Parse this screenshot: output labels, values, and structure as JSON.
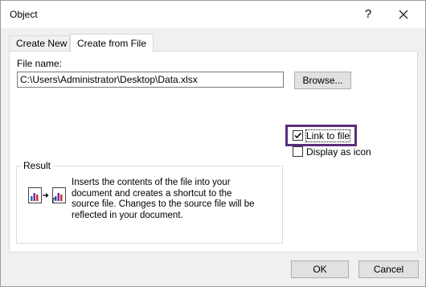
{
  "window": {
    "title": "Object",
    "help_glyph": "?",
    "close_icon": "close-icon"
  },
  "tabs": [
    {
      "label": "Create New",
      "active": false
    },
    {
      "label": "Create from File",
      "active": true
    }
  ],
  "file": {
    "label": "File name:",
    "value": "C:\\Users\\Administrator\\Desktop\\Data.xlsx",
    "browse_label": "Browse..."
  },
  "options": {
    "link_to_file": {
      "label": "Link to file",
      "checked": true
    },
    "display_as_icon": {
      "label": "Display as icon",
      "checked": false
    }
  },
  "result": {
    "legend": "Result",
    "text": "Inserts the contents of the file into your document and creates a shortcut to the source file.  Changes to the source file will be reflected in your document.",
    "icon": "linked-chart-icon"
  },
  "buttons": {
    "ok_label": "OK",
    "cancel_label": "Cancel"
  },
  "colors": {
    "highlight": "#5b2d7d"
  }
}
